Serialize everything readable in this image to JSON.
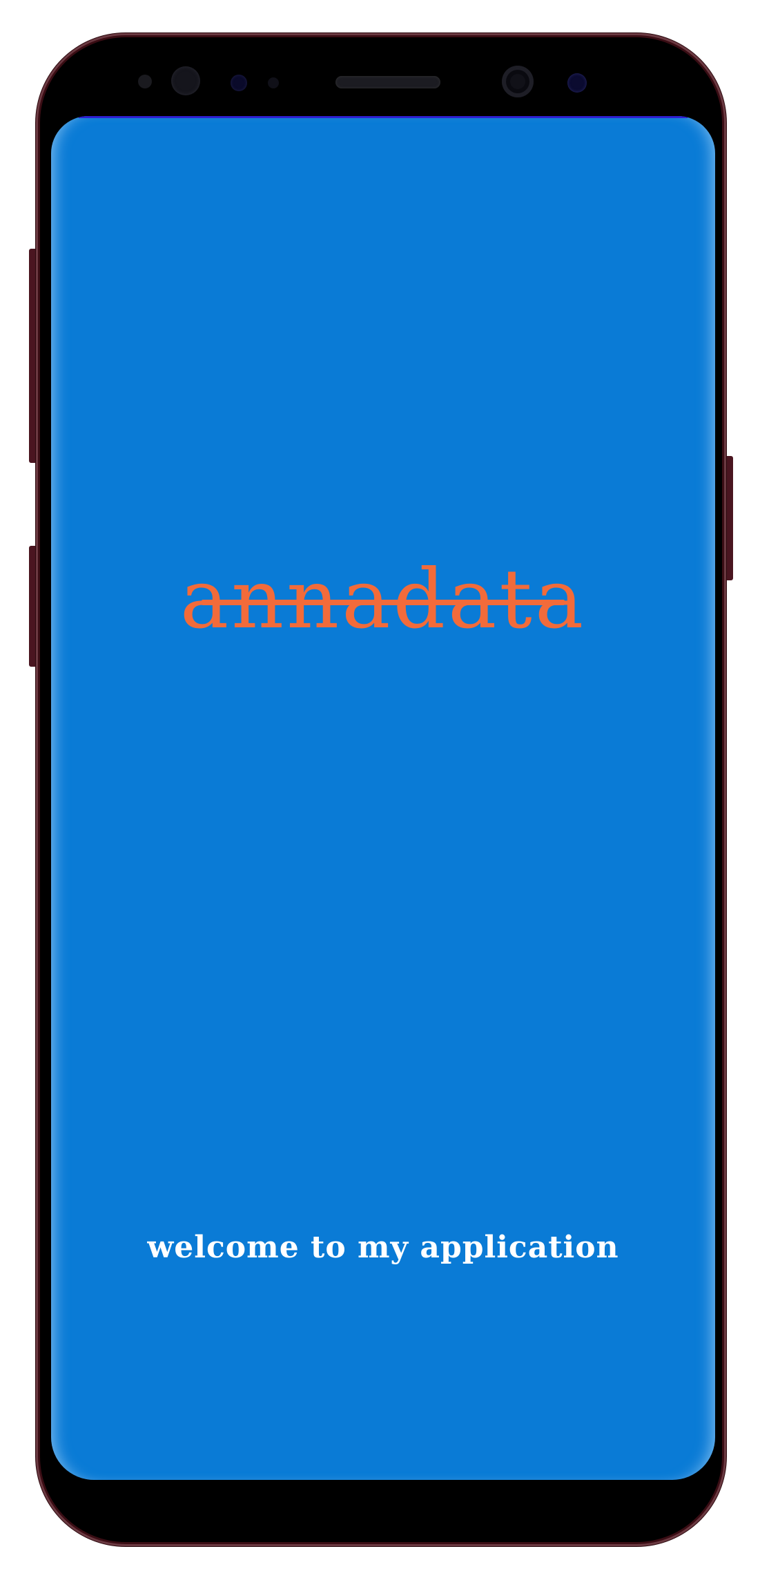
{
  "app": {
    "brand_name": "annadata",
    "welcome_text": "welcome to my application"
  },
  "colors": {
    "screen_background": "#0a7bd6",
    "brand_color": "#f26b3a",
    "welcome_color": "#ffffff",
    "phone_body": "#3a0d14"
  }
}
